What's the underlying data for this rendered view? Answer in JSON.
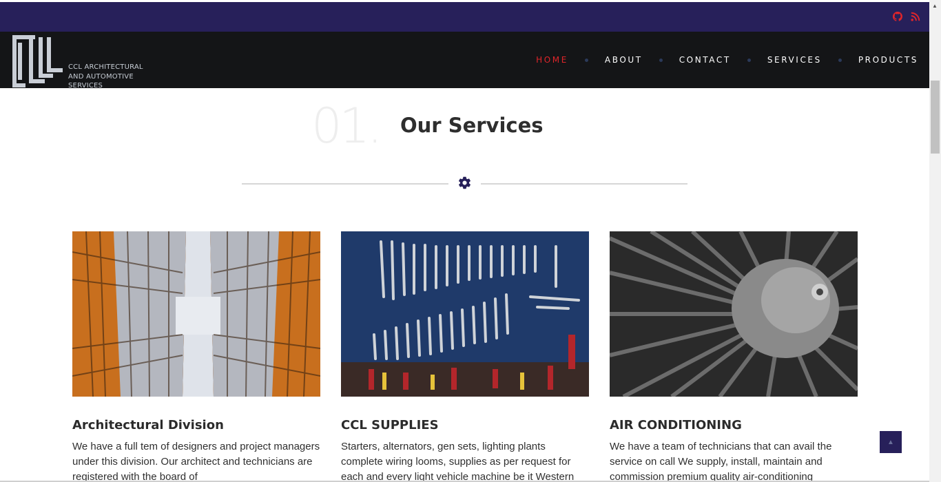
{
  "topbar": {
    "icons": [
      "github-icon",
      "rss-icon"
    ],
    "icon_color": "#e0252a",
    "background": "#27205a"
  },
  "header": {
    "logo": {
      "line1": "CCL ARCHITECTURAL",
      "line2": "AND AUTOMOTIVE",
      "line3": "SERVICES"
    },
    "nav": [
      {
        "label": "HOME",
        "active": true
      },
      {
        "label": "ABOUT",
        "active": false
      },
      {
        "label": "CONTACT",
        "active": false
      },
      {
        "label": "SERVICES",
        "active": false
      },
      {
        "label": "PRODUCTS",
        "active": false
      }
    ],
    "accent": "#e0252a",
    "background": "#141517"
  },
  "section": {
    "number": "01.",
    "title": "Our Services",
    "divider_icon": "gear-icon"
  },
  "cards": [
    {
      "image": "architecture-buildings-photo",
      "title": "Architectural Division",
      "text": "We have a full tem of designers and project managers under this division. Our architect and technicians are registered with the board of"
    },
    {
      "image": "tools-wrenches-wall-photo",
      "title": "CCL SUPPLIES",
      "text": "Starters, alternators, gen sets, lighting plants complete wiring looms, supplies as per request for each and every light vehicle machine be it Western"
    },
    {
      "image": "jet-engine-turbine-photo",
      "title": "AIR CONDITIONING",
      "text": "We have a team of technicians that can avail the service on call We supply, install, maintain and commission premium quality air-conditioning"
    }
  ],
  "back_to_top": {
    "icon": "chevron-up-icon"
  }
}
